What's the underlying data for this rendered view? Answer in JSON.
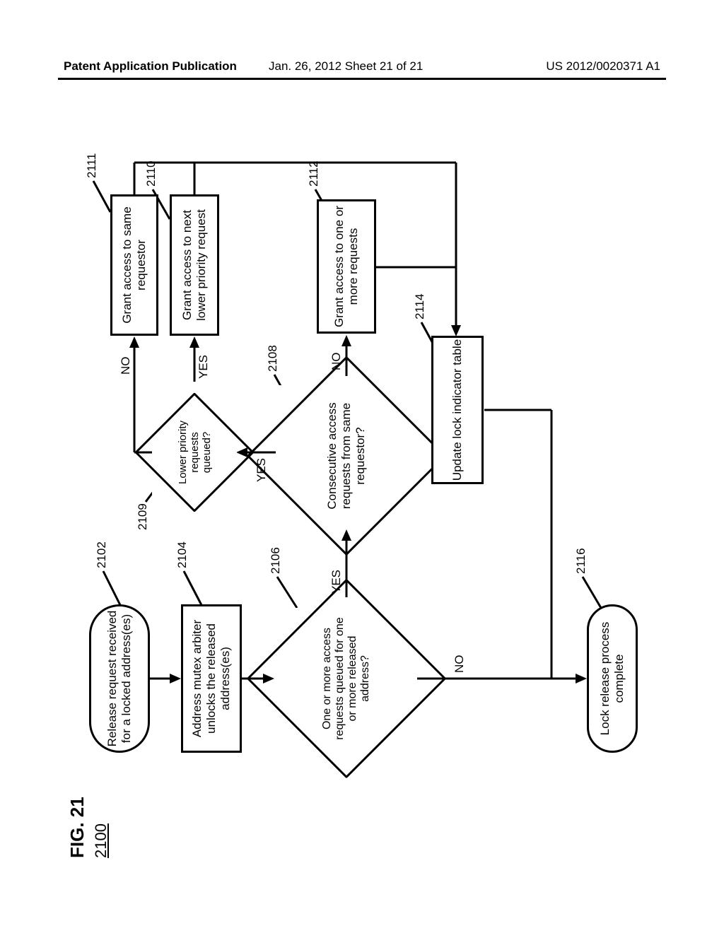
{
  "header": {
    "left": "Patent Application Publication",
    "center": "Jan. 26, 2012  Sheet 21 of 21",
    "right": "US 2012/0020371 A1"
  },
  "figure": {
    "title": "FIG. 21",
    "number": "2100"
  },
  "refs": {
    "r2102": "2102",
    "r2104": "2104",
    "r2106": "2106",
    "r2108": "2108",
    "r2109": "2109",
    "r2110": "2110",
    "r2111": "2111",
    "r2112": "2112",
    "r2114": "2114",
    "r2116": "2116"
  },
  "nodes": {
    "n2102": "Release request received for a locked address(es)",
    "n2104": "Address mutex arbiter unlocks the released address(es)",
    "n2106": "One or more access requests queued for one or more released address?",
    "n2108": "Consecutive access requests from same requestor?",
    "n2109": "Lower priority requests queued?",
    "n2110": "Grant access to next lower priority request",
    "n2111": "Grant access to same requestor",
    "n2112": "Grant access to one or more requests",
    "n2114": "Update lock indicator table",
    "n2116": "Lock release process complete"
  },
  "paths": {
    "yes": "YES",
    "no": "NO"
  }
}
